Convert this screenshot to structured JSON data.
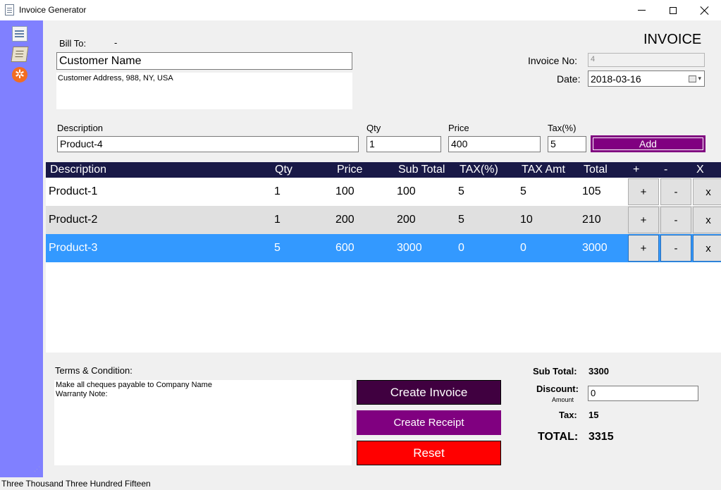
{
  "window": {
    "title": "Invoice Generator"
  },
  "sidebar": {
    "items": [
      {
        "icon": "invoice-doc-icon"
      },
      {
        "icon": "receipt-icon"
      },
      {
        "icon": "gear-icon",
        "glyph": "✲"
      }
    ]
  },
  "bill_to": {
    "label": "Bill To:",
    "value": "-",
    "customer_name": "Customer Name",
    "address": "Customer Address, 988, NY, USA"
  },
  "invoice": {
    "heading": "INVOICE",
    "number_label": "Invoice No:",
    "number_value": "4",
    "date_label": "Date:",
    "date_value": "2018-03-16"
  },
  "entry": {
    "description_label": "Description",
    "description_value": "Product-4",
    "qty_label": "Qty",
    "qty_value": "1",
    "price_label": "Price",
    "price_value": "400",
    "tax_label": "Tax(%)",
    "tax_value": "5",
    "add_label": "Add"
  },
  "grid": {
    "columns": [
      "Description",
      "Qty",
      "Price",
      "Sub Total",
      "TAX(%)",
      "TAX Amt",
      "Total",
      "+",
      "-",
      "X"
    ],
    "rows": [
      {
        "description": "Product-1",
        "qty": "1",
        "price": "100",
        "subtotal": "100",
        "tax_pct": "5",
        "tax_amt": "5",
        "total": "105",
        "plus": "+",
        "minus": "-",
        "remove": "x"
      },
      {
        "description": "Product-2",
        "qty": "1",
        "price": "200",
        "subtotal": "200",
        "tax_pct": "5",
        "tax_amt": "10",
        "total": "210",
        "plus": "+",
        "minus": "-",
        "remove": "x"
      },
      {
        "description": "Product-3",
        "qty": "5",
        "price": "600",
        "subtotal": "3000",
        "tax_pct": "0",
        "tax_amt": "0",
        "total": "3000",
        "plus": "+",
        "minus": "-",
        "remove": "x"
      }
    ],
    "selected_row": 2,
    "colors": {
      "header": "#191947",
      "row_alt": "#e0e0e0",
      "selected": "#3399ff"
    }
  },
  "terms": {
    "label": "Terms & Condition:",
    "text": "Make all cheques payable to Company Name\nWarranty Note:"
  },
  "actions": {
    "create_invoice": "Create Invoice",
    "create_receipt": "Create Receipt",
    "reset": "Reset",
    "colors": {
      "create_invoice": "#400040",
      "create_receipt": "#800080",
      "reset": "#ff0000"
    }
  },
  "summary": {
    "subtotal_label": "Sub Total:",
    "subtotal_value": "3300",
    "discount_label": "Discount:",
    "discount_sub_label": "Amount",
    "discount_value": "0",
    "tax_label": "Tax:",
    "tax_value": "15",
    "total_label": "TOTAL:",
    "total_value": "3315"
  },
  "status": {
    "amount_in_words": "Three Thousand Three Hundred Fifteen"
  }
}
